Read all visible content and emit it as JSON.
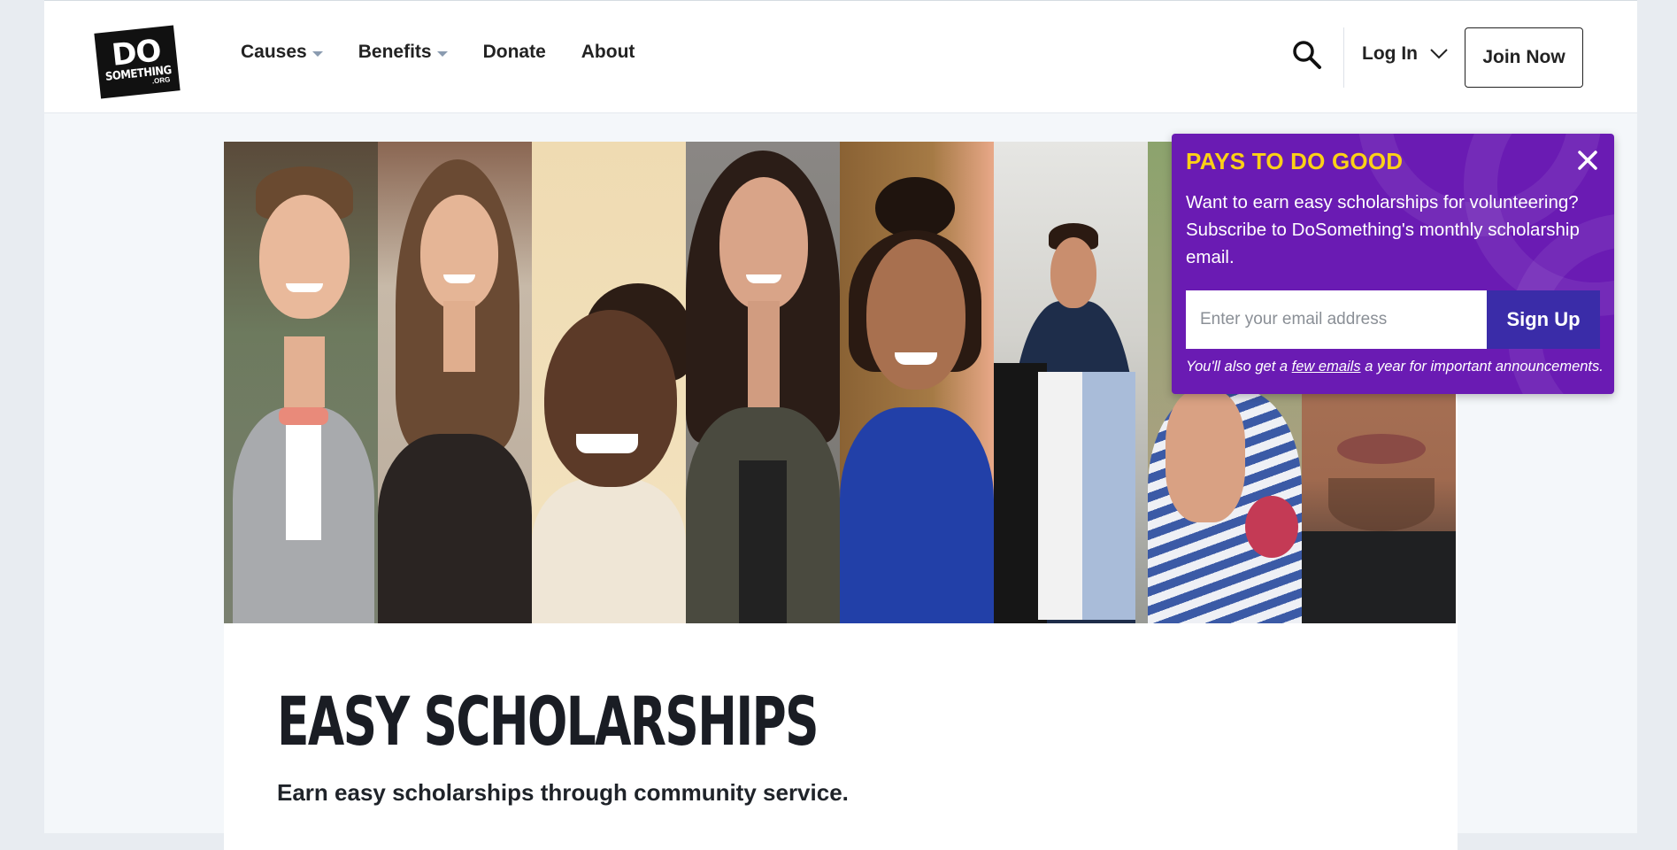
{
  "header": {
    "logo": {
      "line1": "DO",
      "line2": "SOMETHING",
      "line3": ".ORG"
    },
    "nav": [
      {
        "label": "Causes",
        "has_dropdown": true
      },
      {
        "label": "Benefits",
        "has_dropdown": true
      },
      {
        "label": "Donate",
        "has_dropdown": false
      },
      {
        "label": "About",
        "has_dropdown": false
      }
    ],
    "search_icon": "search-icon",
    "login_label": "Log In",
    "join_label": "Join Now"
  },
  "hero": {
    "title": "EASY SCHOLARSHIPS",
    "subtitle": "Earn easy scholarships through community service."
  },
  "popup": {
    "title": "PAYS TO DO GOOD",
    "body": "Want to earn easy scholarships for volunteering? Subscribe to DoSomething's monthly scholarship email.",
    "email_placeholder": "Enter your email address",
    "email_value": "",
    "signup_label": "Sign Up",
    "note_before": "You'll also get a ",
    "note_link": "few emails",
    "note_after": " a year for important announcements.",
    "close_icon": "close-icon"
  },
  "colors": {
    "popup_bg": "#6a1bb3",
    "popup_title": "#fcd116",
    "signup_bg": "#3a2ca8",
    "page_bg": "#f4f7fa"
  }
}
